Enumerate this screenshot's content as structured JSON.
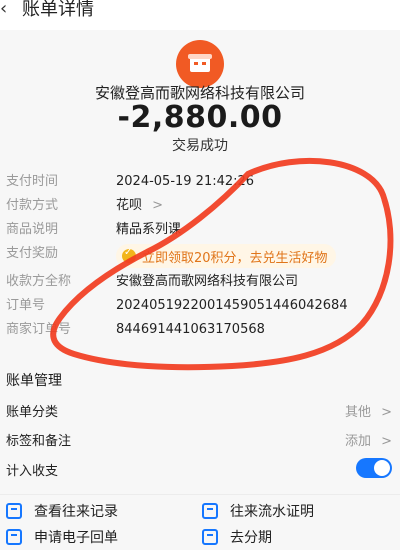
{
  "header": {
    "back_icon": "chevron-left-icon",
    "title": "账单详情"
  },
  "summary": {
    "merchant": "安徽登高而歌网络科技有限公司",
    "amount": "-2,880.00",
    "status": "交易成功",
    "logo_color": "#f15a24"
  },
  "details": [
    {
      "label": "支付时间",
      "value": "2024-05-19 21:42:26"
    },
    {
      "label": "付款方式",
      "value": "花呗",
      "chevron": ">"
    },
    {
      "label": "商品说明",
      "value": "精品系列课"
    },
    {
      "label": "支付奖励",
      "value": "立即领取20积分，去兑生活好物"
    },
    {
      "label": "收款方全称",
      "value": "安徽登高而歌网络科技有限公司"
    },
    {
      "label": "订单号",
      "value": "20240519220014590514460426​84"
    },
    {
      "label": "商家订单号",
      "value": "844691441063170568"
    }
  ],
  "management": {
    "title": "账单管理",
    "items": [
      {
        "name": "账单分类",
        "value": "其他",
        "chevron": ">"
      },
      {
        "name": "标签和备注",
        "value": "添加",
        "chevron": ">"
      },
      {
        "name": "计入收支",
        "toggle_on": true
      }
    ]
  },
  "actions": [
    {
      "label": "查看往来记录",
      "icon": "record-icon"
    },
    {
      "label": "往来流水证明",
      "icon": "certificate-icon"
    },
    {
      "label": "申请电子回单",
      "icon": "receipt-icon"
    },
    {
      "label": "去分期",
      "icon": "installment-icon"
    }
  ],
  "colors": {
    "accent_blue": "#1677ff",
    "reward_orange": "#e0751a",
    "annotation_red": "#f13c1f"
  }
}
